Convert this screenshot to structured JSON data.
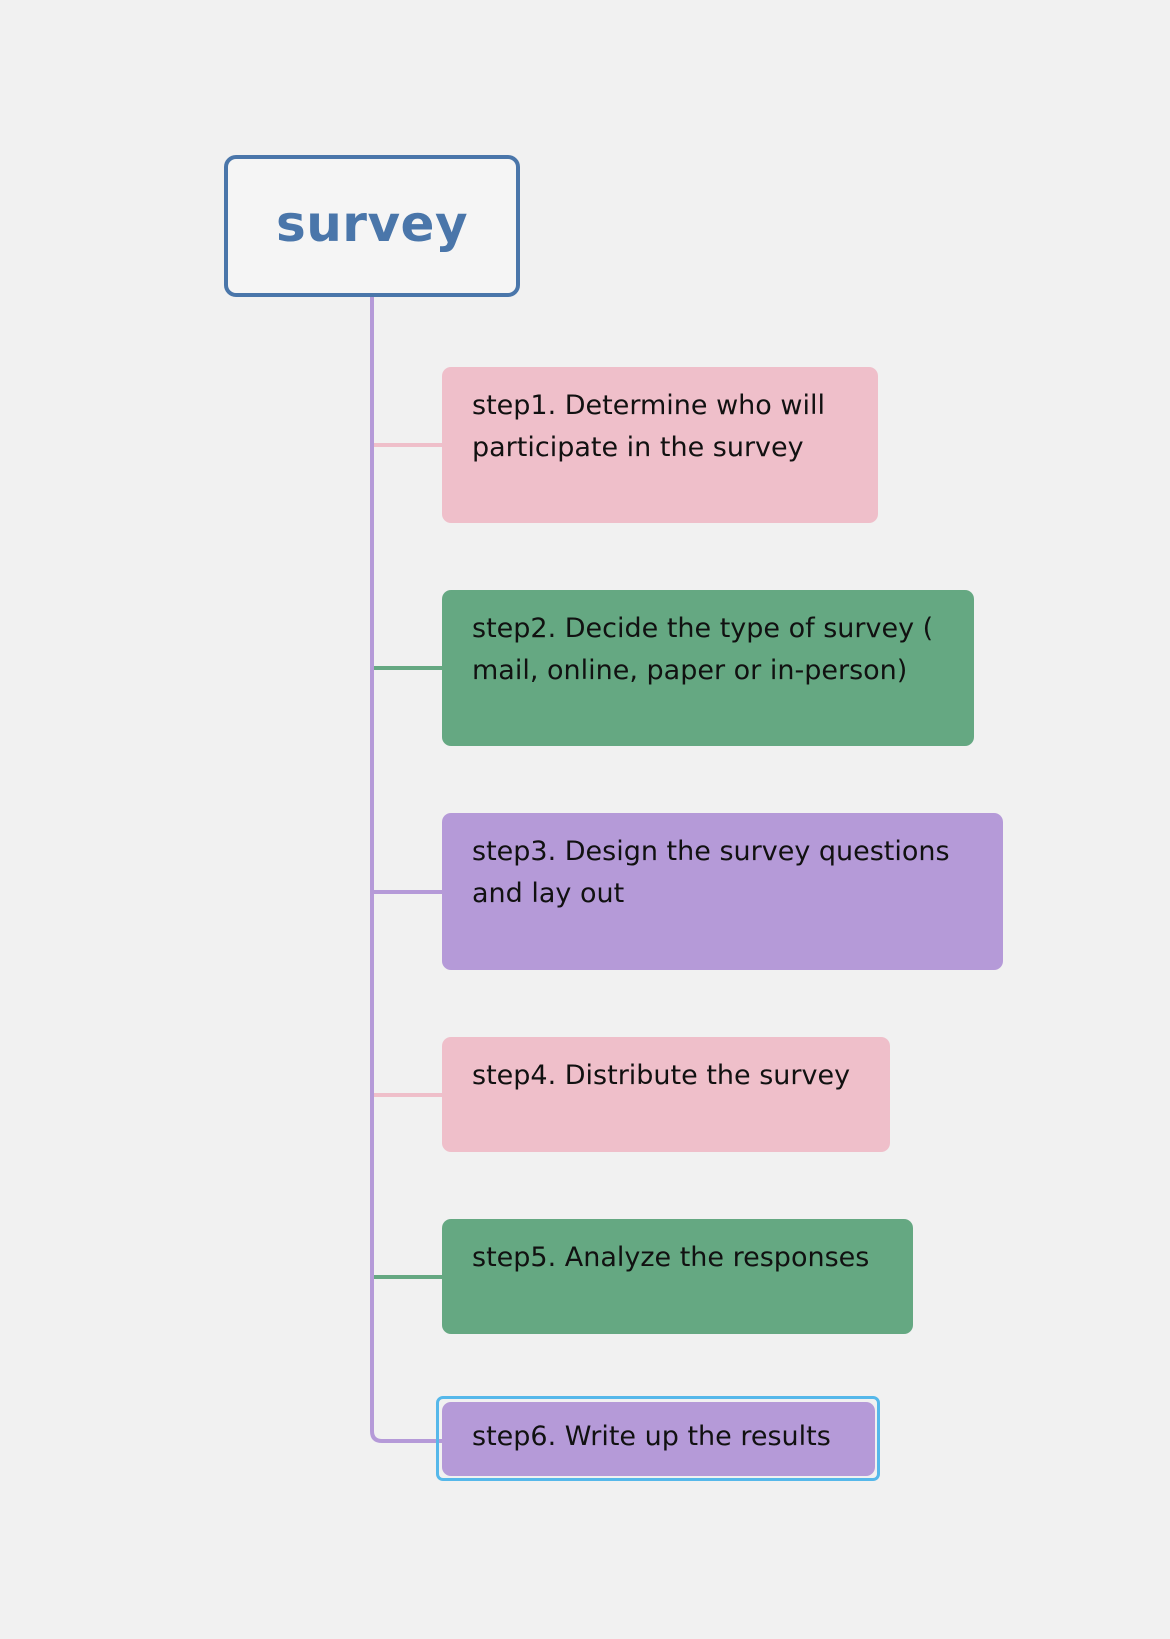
{
  "diagram": {
    "root": {
      "label": "survey",
      "border_color": "#4a76aa"
    },
    "trunk_color": "#b59ad8",
    "steps": [
      {
        "lines": [
          "step1. Determine who will",
          "participate in the survey"
        ],
        "fill": "#efbfca",
        "connector_color": "#efbfca"
      },
      {
        "lines": [
          "step2. Decide the type of survey (",
          "mail, online, paper or in-person)"
        ],
        "fill": "#65a882",
        "connector_color": "#65a882"
      },
      {
        "lines": [
          "step3. Design the survey questions",
          "and lay out"
        ],
        "fill": "#b59ad8",
        "connector_color": "#b59ad8"
      },
      {
        "lines": [
          "step4. Distribute the survey"
        ],
        "fill": "#efbfca",
        "connector_color": "#efbfca"
      },
      {
        "lines": [
          "step5. Analyze the responses"
        ],
        "fill": "#65a882",
        "connector_color": "#65a882"
      },
      {
        "lines": [
          "step6. Write up the results"
        ],
        "fill": "#b59ad8",
        "connector_color": "#b59ad8",
        "selected": true
      }
    ],
    "selection_color": "#56b8ea"
  }
}
